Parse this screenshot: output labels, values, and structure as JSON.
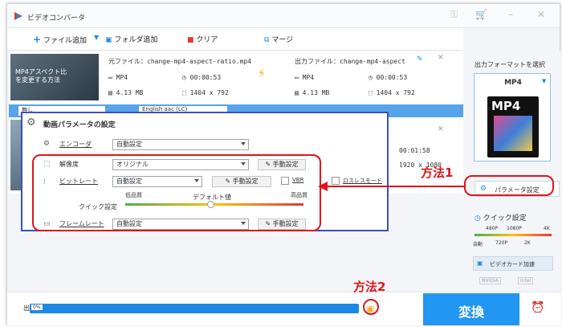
{
  "app": {
    "title": "ビデオコンバータ"
  },
  "toolbar": {
    "add_file": "ファイル追加",
    "add_folder": "フォルダ追加",
    "clear": "クリア",
    "merge": "マージ"
  },
  "file": {
    "source_label": "元ファイル：change-mp4-aspect-ratio.mp4",
    "output_label": "出力ファイル：change-mp4-aspect",
    "src_format": "MP4",
    "src_duration": "00:00:53",
    "src_size": "4.13 MB",
    "src_res": "1404 x 792",
    "out_format": "MP4",
    "out_duration": "00:00:53",
    "out_size": "4.13 MB",
    "out_res": "1404 x 792",
    "thumb_text": "MP4アスペクト比を変更する方法",
    "row2_duration": "00:01:58",
    "row2_res": "1920 x 1080",
    "subtitle_sel": "無し",
    "audio_sel": "English aac (LC)"
  },
  "right_panel": {
    "heading": "出力フォーマットを選択",
    "format": "MP4",
    "param_button": "パラメータ設定",
    "quick_heading": "クイック設定",
    "scale_top": [
      "480P",
      "1080P",
      "4K"
    ],
    "scale_bottom": [
      "自動",
      "720P",
      "2K"
    ],
    "gpu": "ビデオカード加速",
    "chips": [
      "NVIDIA",
      "Intel"
    ]
  },
  "dialog": {
    "title": "動画パラメータの設定",
    "encoder_label": "エンコーダ",
    "encoder_value": "自動設定",
    "resolution_label": "解像度",
    "resolution_value": "オリジナル",
    "resolution_manual": "手動設定",
    "bitrate_label": "ビットレート",
    "bitrate_value": "自動設定",
    "bitrate_manual": "手動設定",
    "vbr": "VBR",
    "lossless": "ロスレスモード",
    "quick_label": "クイック設定",
    "low_q": "低品質",
    "default_val": "デフォルト値",
    "high_q": "高品質",
    "framerate_label": "フレームレート",
    "framerate_value": "自動設定",
    "framerate_manual": "手動設定"
  },
  "bottom": {
    "progress_pct": "0%",
    "progress": 0.0,
    "convert": "変換",
    "path_prefix": "出"
  },
  "annotations": {
    "method1": "方法1",
    "method2": "方法2"
  },
  "colors": {
    "accent": "#1e88e5",
    "highlight": "#e0151b",
    "dialog_border": "#3f51b5"
  }
}
